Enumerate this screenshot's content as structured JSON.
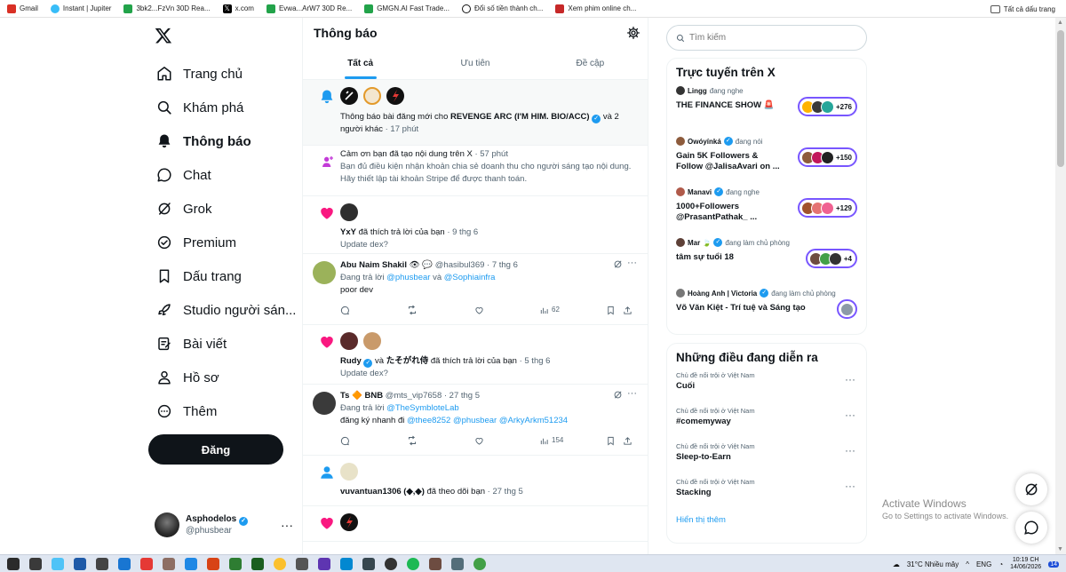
{
  "bookmarks": [
    {
      "label": "Gmail",
      "color": "#d93025"
    },
    {
      "label": "Instant | Jupiter",
      "color": "#38bdf8"
    },
    {
      "label": "3bk2...FzVn 30D Rea...",
      "color": "#22a34a"
    },
    {
      "label": "x.com",
      "color": "#000000"
    },
    {
      "label": "Evwa...ArW7 30D Re...",
      "color": "#22a34a"
    },
    {
      "label": "GMGN.AI Fast Trade...",
      "color": "#22a34a"
    },
    {
      "label": "Đổi số tiền thành ch...",
      "color": "#111111"
    },
    {
      "label": "Xem phim online ch...",
      "color": "#c62828"
    }
  ],
  "bookmarks_all": "Tất cả dấu trang",
  "nav": [
    {
      "label": "Trang chủ",
      "icon": "home-icon"
    },
    {
      "label": "Khám phá",
      "icon": "search-icon"
    },
    {
      "label": "Thông báo",
      "icon": "bell-icon",
      "active": true
    },
    {
      "label": "Chat",
      "icon": "chat-icon"
    },
    {
      "label": "Grok",
      "icon": "grok-icon"
    },
    {
      "label": "Premium",
      "icon": "premium-icon"
    },
    {
      "label": "Dấu trang",
      "icon": "bookmark-icon"
    },
    {
      "label": "Studio người sán...",
      "icon": "rocket-icon"
    },
    {
      "label": "Bài viết",
      "icon": "article-icon"
    },
    {
      "label": "Hồ sơ",
      "icon": "person-icon"
    },
    {
      "label": "Thêm",
      "icon": "more-circle-icon"
    }
  ],
  "post_label": "Đăng",
  "account": {
    "name": "Asphodelos",
    "handle": "@phusbear"
  },
  "main": {
    "title": "Thông báo",
    "tabs": [
      "Tất cả",
      "Ưu tiên",
      "Đề cập"
    ]
  },
  "n1": {
    "text": "Thông báo bài đăng mới cho ",
    "name": "REVENGE ARC (I'M HIM. BIO/ACC)",
    "tail": " và 2 người khác",
    "time": " · 17 phút"
  },
  "n2": {
    "title": "Cảm ơn bạn đã tạo nội dung trên X",
    "time": " · 57 phút",
    "desc": "Bạn đủ điều kiện nhận khoản chia sẻ doanh thu cho người sáng tạo nội dung. Hãy thiết lập tài khoản Stripe để được thanh toán."
  },
  "n3": {
    "name": "YxY",
    "text": " đã thích trả lời của bạn",
    "time": " · 9 thg 6",
    "sub": "Update dex?"
  },
  "t1": {
    "name": "Abu Naim Shakil",
    "emoji": "👁 💬",
    "handle": "@hasibul369",
    "time": " · 7 thg 6",
    "reply_prefix": "Đang trả lời ",
    "m1": "@phusbear",
    "and": " và ",
    "m2": "@Sophiainfra",
    "text": "poor dev",
    "views": "62"
  },
  "n4": {
    "name": "Rudy",
    "and": " và ",
    "name2": "たそがれ侍",
    "text": " đã thích trả lời của bạn",
    "time": " · 5 thg 6",
    "sub": "Update dex?"
  },
  "t2": {
    "name": "Ts 🔶 BNB",
    "handle": "@mts_vip7658",
    "time": " · 27 thg 5",
    "reply_prefix": "Đang trả lời ",
    "m1": "@TheSymbloteLab",
    "pre": "đăng ký nhanh đi ",
    "m2": "@thee8252",
    "m3": "@phusbear",
    "m4": "@ArkyArkm51234",
    "views": "154"
  },
  "n5": {
    "name": "vuvantuan1306 (◆,◆)",
    "text": " đã theo dõi bạn",
    "time": " · 27 thg 5"
  },
  "search_placeholder": "Tìm kiếm",
  "spaces": {
    "title": "Trực tuyến trên X",
    "items": [
      {
        "host": "Lingg",
        "status": "đang nghe",
        "title": "THE FINANCE SHOW 🚨",
        "count": "+276",
        "verified": false
      },
      {
        "host": "Owóyínká",
        "status": "đang nói",
        "title": "Gain 5K Followers & Follow @JalisaAvari on ...",
        "count": "+150",
        "verified": true
      },
      {
        "host": "Manavi",
        "status": "đang nghe",
        "title": "1000+Followers @PrasantPathak_ ...",
        "count": "+129",
        "verified": true
      },
      {
        "host": "Mar 🍃",
        "status": "đang làm chủ phòng",
        "title": "tâm sự tuổi 18",
        "count": "+4",
        "verified": true
      },
      {
        "host": "Hoàng Anh | Victoria",
        "status": "đang làm chủ phòng",
        "title": "Võ Văn Kiệt - Trí tuệ và Sáng tạo",
        "count": "",
        "verified": true
      }
    ]
  },
  "trends": {
    "title": "Những điều đang diễn ra",
    "items": [
      {
        "category": "Chủ đề nổi trội ở Việt Nam",
        "title": "Cuối"
      },
      {
        "category": "Chủ đề nổi trội ở Việt Nam",
        "title": "#comemyway"
      },
      {
        "category": "Chủ đề nổi trội ở Việt Nam",
        "title": "Sleep-to-Earn"
      },
      {
        "category": "Chủ đề nổi trội ở Việt Nam",
        "title": "Stacking"
      }
    ],
    "show_more": "Hiển thị thêm"
  },
  "watermark": {
    "title": "Activate Windows",
    "sub": "Go to Settings to activate Windows."
  },
  "taskbar": {
    "weather": "31°C Nhiều mây",
    "lang": "ENG",
    "time": "10:19 CH",
    "date": "14/06/2026",
    "badge": "14"
  },
  "colors": {
    "accent": "#1d9bf0",
    "like": "#f91880",
    "verified": "#1d9bf0",
    "space": "#7856ff"
  }
}
